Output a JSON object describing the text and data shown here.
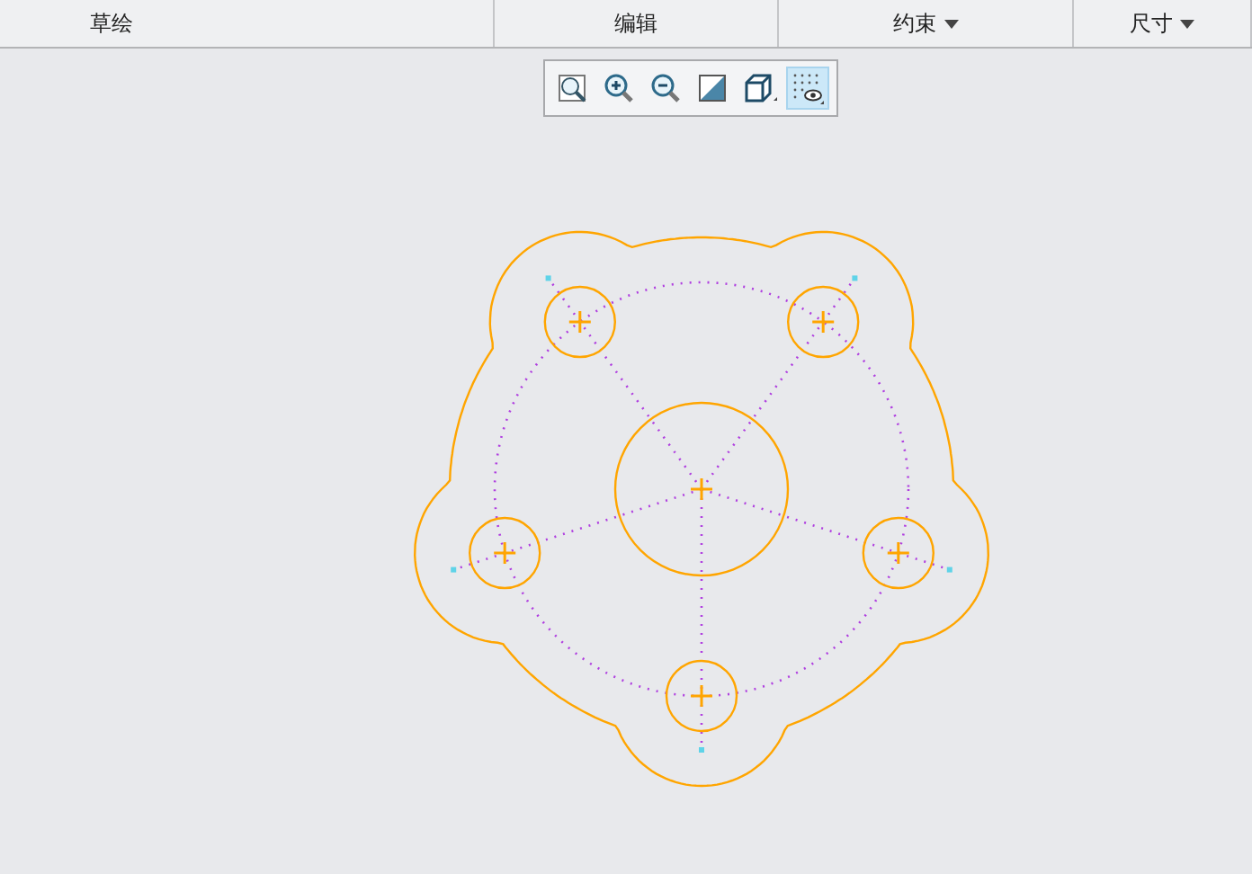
{
  "ribbon_groups": [
    {
      "label": "草绘",
      "dropdown": false
    },
    {
      "label": "编辑",
      "dropdown": false
    },
    {
      "label": "约束",
      "dropdown": true
    },
    {
      "label": "尺寸",
      "dropdown": true
    }
  ],
  "view_toolbar": [
    {
      "kind": "refit",
      "selected": false
    },
    {
      "kind": "zoom_in",
      "selected": false
    },
    {
      "kind": "zoom_out",
      "selected": false
    },
    {
      "kind": "reorient",
      "selected": false
    },
    {
      "kind": "display_style",
      "selected": false
    },
    {
      "kind": "sketch_display",
      "selected": true
    }
  ]
}
